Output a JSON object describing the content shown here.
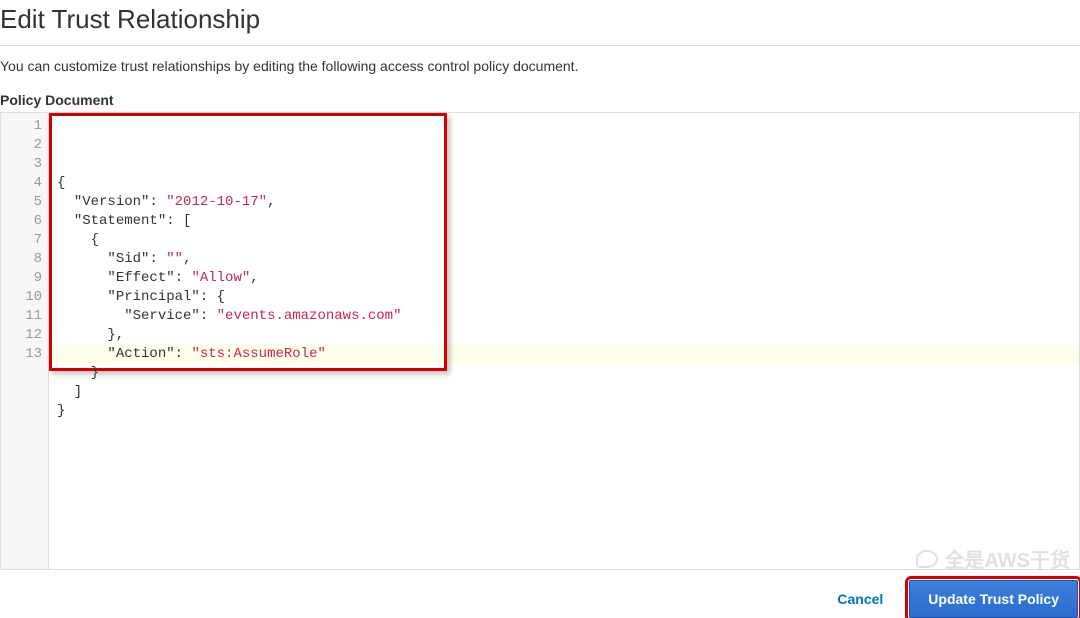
{
  "header": {
    "title": "Edit Trust Relationship"
  },
  "description": "You can customize trust relationships by editing the following access control policy document.",
  "section_label": "Policy Document",
  "editor": {
    "line_numbers": [
      "1",
      "2",
      "3",
      "4",
      "5",
      "6",
      "7",
      "8",
      "9",
      "10",
      "11",
      "12",
      "13"
    ],
    "lines": [
      [
        {
          "t": "{",
          "c": "punct"
        }
      ],
      [
        {
          "t": "  ",
          "c": "punct"
        },
        {
          "t": "\"Version\"",
          "c": "key"
        },
        {
          "t": ": ",
          "c": "punct"
        },
        {
          "t": "\"2012-10-17\"",
          "c": "str"
        },
        {
          "t": ",",
          "c": "punct"
        }
      ],
      [
        {
          "t": "  ",
          "c": "punct"
        },
        {
          "t": "\"Statement\"",
          "c": "key"
        },
        {
          "t": ": [",
          "c": "punct"
        }
      ],
      [
        {
          "t": "    {",
          "c": "punct"
        }
      ],
      [
        {
          "t": "      ",
          "c": "punct"
        },
        {
          "t": "\"Sid\"",
          "c": "key"
        },
        {
          "t": ": ",
          "c": "punct"
        },
        {
          "t": "\"\"",
          "c": "str"
        },
        {
          "t": ",",
          "c": "punct"
        }
      ],
      [
        {
          "t": "      ",
          "c": "punct"
        },
        {
          "t": "\"Effect\"",
          "c": "key"
        },
        {
          "t": ": ",
          "c": "punct"
        },
        {
          "t": "\"Allow\"",
          "c": "str"
        },
        {
          "t": ",",
          "c": "punct"
        }
      ],
      [
        {
          "t": "      ",
          "c": "punct"
        },
        {
          "t": "\"Principal\"",
          "c": "key"
        },
        {
          "t": ": {",
          "c": "punct"
        }
      ],
      [
        {
          "t": "        ",
          "c": "punct"
        },
        {
          "t": "\"Service\"",
          "c": "key"
        },
        {
          "t": ": ",
          "c": "punct"
        },
        {
          "t": "\"events.amazonaws.com\"",
          "c": "str"
        }
      ],
      [
        {
          "t": "      },",
          "c": "punct"
        }
      ],
      [
        {
          "t": "      ",
          "c": "punct"
        },
        {
          "t": "\"Action\"",
          "c": "key"
        },
        {
          "t": ": ",
          "c": "punct"
        },
        {
          "t": "\"sts:AssumeRole\"",
          "c": "str"
        }
      ],
      [
        {
          "t": "    }",
          "c": "punct"
        }
      ],
      [
        {
          "t": "  ]",
          "c": "punct"
        }
      ],
      [
        {
          "t": "}",
          "c": "punct"
        }
      ]
    ],
    "raw_json": "{\n  \"Version\": \"2012-10-17\",\n  \"Statement\": [\n    {\n      \"Sid\": \"\",\n      \"Effect\": \"Allow\",\n      \"Principal\": {\n        \"Service\": \"events.amazonaws.com\"\n      },\n      \"Action\": \"sts:AssumeRole\"\n    }\n  ]\n}"
  },
  "footer": {
    "cancel_label": "Cancel",
    "update_label": "Update Trust Policy"
  },
  "watermark": {
    "text": "全是AWS干货"
  },
  "colors": {
    "primary_button": "#2a6cd1",
    "link": "#0073bb",
    "highlight_border": "#d40000",
    "string_token": "#c7254e"
  }
}
